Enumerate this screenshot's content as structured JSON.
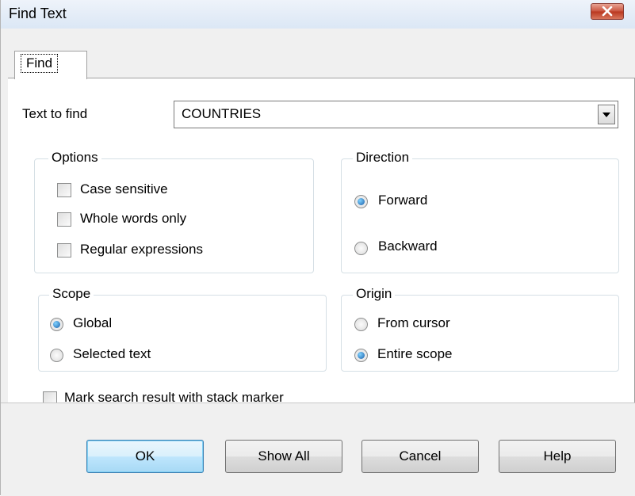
{
  "window": {
    "title": "Find Text"
  },
  "tabs": [
    {
      "label": "Find"
    }
  ],
  "text_to_find": {
    "label": "Text to find",
    "value": "COUNTRIES"
  },
  "options": {
    "title": "Options",
    "items": [
      {
        "label": "Case sensitive",
        "checked": false
      },
      {
        "label": "Whole words only",
        "checked": false
      },
      {
        "label": "Regular expressions",
        "checked": false
      }
    ]
  },
  "direction": {
    "title": "Direction",
    "items": [
      {
        "label": "Forward",
        "selected": true
      },
      {
        "label": "Backward",
        "selected": false
      }
    ]
  },
  "scope": {
    "title": "Scope",
    "items": [
      {
        "label": "Global",
        "selected": true
      },
      {
        "label": "Selected text",
        "selected": false
      }
    ]
  },
  "origin": {
    "title": "Origin",
    "items": [
      {
        "label": "From cursor",
        "selected": false
      },
      {
        "label": "Entire scope",
        "selected": true
      }
    ]
  },
  "mark_result": {
    "label": "Mark search result with stack marker",
    "checked": false
  },
  "buttons": {
    "ok": "OK",
    "show_all": "Show All",
    "cancel": "Cancel",
    "help": "Help"
  },
  "colors": {
    "close_button": "#c9533d",
    "radio_selected": "#1b5ea8",
    "default_button_border": "#3c7fb1"
  }
}
